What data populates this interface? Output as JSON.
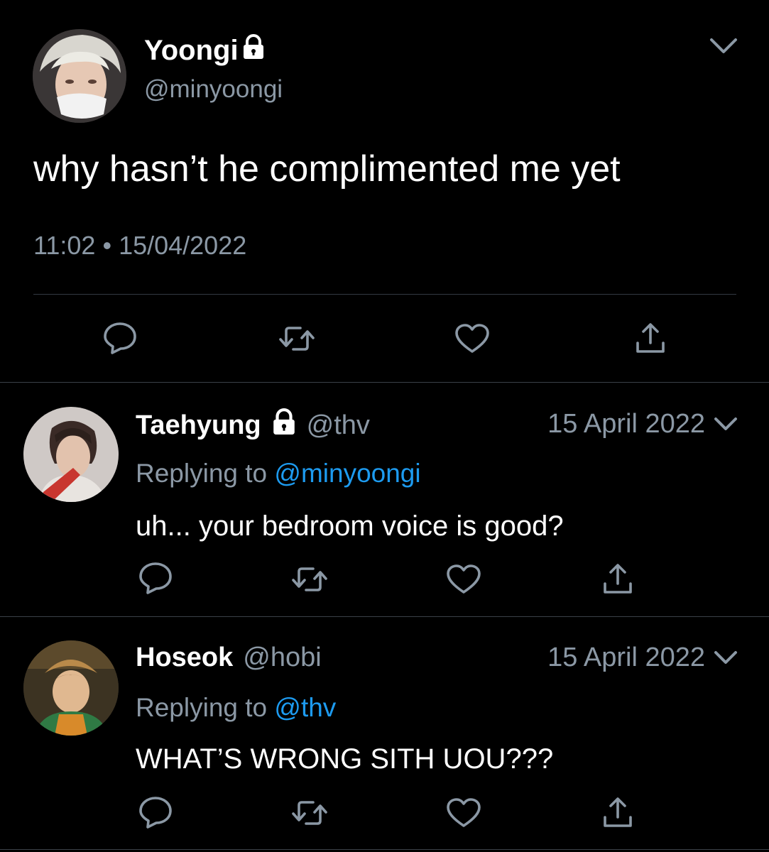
{
  "main_tweet": {
    "display_name": "Yoongi",
    "handle": "@minyoongi",
    "text": "why hasn’t he complimented me yet",
    "time": "11:02",
    "separator": "•",
    "date": "15/04/2022",
    "protected": true
  },
  "replies": [
    {
      "display_name": "Taehyung",
      "handle": "@thv",
      "protected": true,
      "date": "15 April 2022",
      "replying_prefix": "Replying to ",
      "replying_to": "@minyoongi",
      "text": "uh... your bedroom voice is good?"
    },
    {
      "display_name": "Hoseok",
      "handle": "@hobi",
      "protected": false,
      "date": "15 April 2022",
      "replying_prefix": "Replying to ",
      "replying_to": "@thv",
      "text": "WHAT’S WRONG SITH UOU???"
    }
  ],
  "icons": {
    "reply": "speech-bubble-icon",
    "retweet": "retweet-arrows-icon",
    "like": "heart-icon",
    "share": "share-upload-icon",
    "menu": "chevron-down-icon",
    "protected": "lock-icon"
  },
  "colors": {
    "background": "#000000",
    "text_primary": "#ffffff",
    "text_secondary": "#8b98a5",
    "link": "#1d9bf0",
    "divider": "#3b4148"
  }
}
